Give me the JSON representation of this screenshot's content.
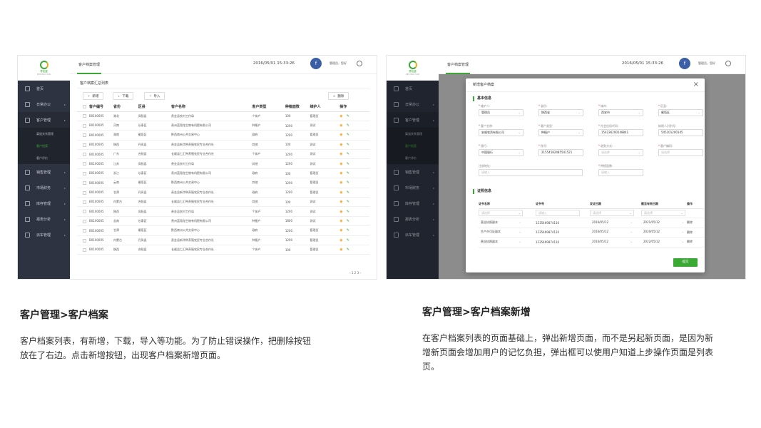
{
  "left": {
    "logo": {
      "name": "青松盛",
      "sub": "ZBSINGYUAN"
    },
    "tab": "客户档案管理",
    "clock": "2016/05/01  15:33:26",
    "user": "管理员，您好",
    "menu": [
      {
        "label": "首页",
        "icon": "home-icon"
      },
      {
        "label": "日常办公",
        "icon": "calendar-icon"
      },
      {
        "label": "客户管理",
        "icon": "user-icon"
      },
      {
        "label": "销售管理",
        "icon": "sales-icon"
      },
      {
        "label": "市场财务",
        "icon": "finance-icon"
      },
      {
        "label": "库存管理",
        "icon": "warehouse-icon"
      },
      {
        "label": "报表分析",
        "icon": "report-icon"
      },
      {
        "label": "派车管理",
        "icon": "truck-icon"
      }
    ],
    "submenu": [
      "渠道关系管理",
      "客户档案",
      "客户评价"
    ],
    "panel_title": "客户档案汇总列表",
    "buttons": {
      "add": "新增",
      "download": "下载",
      "import": "导入",
      "delete": "删除"
    },
    "columns": [
      "客户编号",
      "省份",
      "区县",
      "客户名称",
      "客户类型",
      "种植面数",
      "维护人",
      "操作"
    ],
    "rows": [
      [
        "B0100005",
        "湖北",
        "凤阳县",
        "贵金县农村工作局",
        "个体户",
        "100",
        "管理员"
      ],
      [
        "B0100005",
        "河南",
        "长泰区",
        "贵州蓝翔龙生物有机肥有限公司",
        "种植户",
        "1200",
        "测试"
      ],
      [
        "B0100005",
        "湖南",
        "雁塔区",
        "黔西南州公共交易中心",
        "政府",
        "1200",
        "管理员"
      ],
      [
        "B0100005",
        "陕西",
        "丹凤县",
        "贵金县新华种养殖农民专业合作社",
        "其他",
        "100",
        "测试"
      ],
      [
        "B0100005",
        "广东",
        "合阳县",
        "长顺县仁汇种养殖农民专业合作社",
        "个体户",
        "1200",
        "测试"
      ],
      [
        "B0100005",
        "江苏",
        "凤阳县",
        "贵金县农村工作局",
        "其他",
        "1200",
        "测试"
      ],
      [
        "B0100005",
        "浙江",
        "长泰区",
        "贵州蓝翔龙生物有机肥有限公司",
        "政府",
        "100",
        "管理员"
      ],
      [
        "B0100005",
        "云南",
        "雁塔区",
        "黔西南州公共交易中心",
        "其他",
        "1200",
        "管理员"
      ],
      [
        "B0100005",
        "甘肃",
        "丹凤县",
        "贵金县新华种养殖农民专业合作社",
        "政府",
        "1200",
        "管理员"
      ],
      [
        "B0100005",
        "内蒙古",
        "合阳县",
        "长顺县仁汇种养殖农民专业合作社",
        "其他",
        "100",
        "测试"
      ],
      [
        "B0100005",
        "陕西",
        "凤阳县",
        "贵金县农村工作局",
        "个体户",
        "1200",
        "测试"
      ],
      [
        "B0100005",
        "云南",
        "长泰区",
        "贵州蓝翔龙生物有机肥有限公司",
        "种植户",
        "1800",
        "测试"
      ],
      [
        "B0100005",
        "甘肃",
        "雁塔区",
        "黔西南州公共交易中心",
        "政府",
        "1200",
        "管理员"
      ],
      [
        "B0100005",
        "内蒙古",
        "丹凤县",
        "贵金县新华种养殖农民专业合作社",
        "种植户",
        "1200",
        "管理员"
      ],
      [
        "B0100005",
        "陕西",
        "合阳县",
        "长顺县仁汇种养殖农民专业合作社",
        "个体户",
        "100",
        "管理员"
      ]
    ],
    "pager": "‹  1  2  3  ›"
  },
  "right": {
    "tab": "客户档案管理",
    "clock": "2016/05/01  15:33:26",
    "user": "管理员，您好",
    "modal_title": "新增客户档案",
    "section_basic": "基本信息",
    "section_cert": "证照信息",
    "fields": [
      {
        "label": "维护人:",
        "value": "管理员",
        "placeholder": false,
        "required": true,
        "dropdown": true
      },
      {
        "label": "省份:",
        "value": "陕西省",
        "placeholder": false,
        "required": true,
        "dropdown": true
      },
      {
        "label": "城市:",
        "value": "西安市",
        "placeholder": false,
        "required": true,
        "dropdown": true
      },
      {
        "label": "区县:",
        "value": "雁塔区",
        "placeholder": false,
        "required": true,
        "dropdown": true
      },
      {
        "label": "客户名称:",
        "value": "安顺农资有限公司",
        "placeholder": false,
        "required": true,
        "dropdown": true
      },
      {
        "label": "客户类型:",
        "value": "种植户",
        "placeholder": false,
        "required": true,
        "dropdown": true
      },
      {
        "label": "社会信用代码:",
        "value": "154236200148841",
        "placeholder": false,
        "required": true,
        "dropdown": false
      },
      {
        "label": "纳税人识别号:",
        "value": "545101200145",
        "placeholder": false,
        "required": false,
        "dropdown": false
      },
      {
        "label": "银行:",
        "value": "中国银行",
        "placeholder": false,
        "required": true,
        "dropdown": true
      },
      {
        "label": "账号:",
        "value": "21554582485541521",
        "placeholder": false,
        "required": true,
        "dropdown": false
      },
      {
        "label": "收款方式:",
        "value": "请选择",
        "placeholder": true,
        "required": true,
        "dropdown": true
      },
      {
        "label": "客户编码:",
        "value": "请选择",
        "placeholder": true,
        "required": true,
        "dropdown": false
      },
      {
        "label": "注册地址:",
        "value": "请输入",
        "placeholder": true,
        "required": false,
        "dropdown": false,
        "wide": true
      },
      {
        "label": "种植面数:",
        "value": "请输入",
        "placeholder": true,
        "required": true,
        "dropdown": false
      }
    ],
    "cert_columns": [
      "证书名称",
      "证书号",
      "发证日期",
      "截至有效日期",
      "操作"
    ],
    "cert_filter": [
      "请选择",
      "请输入",
      "请选择",
      "请选择"
    ],
    "cert_rows": [
      [
        "营业执照副本",
        "1235469874110",
        "2016/05/12",
        "2021/05/12",
        "删除"
      ],
      [
        "生产许可证副本",
        "1235469874110",
        "2016/05/12",
        "2020/05/12",
        "删除"
      ],
      [
        "营业执照副本",
        "1235469874110",
        "2016/05/12",
        "2022/05/12",
        "删除"
      ]
    ],
    "submit": "提交"
  },
  "captions": {
    "left_heading": "客户管理>客户档案",
    "left_desc_1": "客户档案列表，有新增，下载，导入等功能。为了防止错误操作，把删除按钮",
    "left_desc_2": "放在了右边。点击新增按钮，出现客户档案新增页面。",
    "right_heading": "客户管理>客户档案新增",
    "right_desc_1": "在客户档案列表的页面基础上，弹出新增页面，而不是另起新页面，是因为新",
    "right_desc_2": "增新页面会增加用户的记忆负担，弹出框可以使用户知道上步操作页面是列表",
    "right_desc_3": "页。"
  },
  "colors": {
    "accent": "#3aaa35",
    "sidebar": "#2d3340",
    "warning": "#f0a020"
  }
}
